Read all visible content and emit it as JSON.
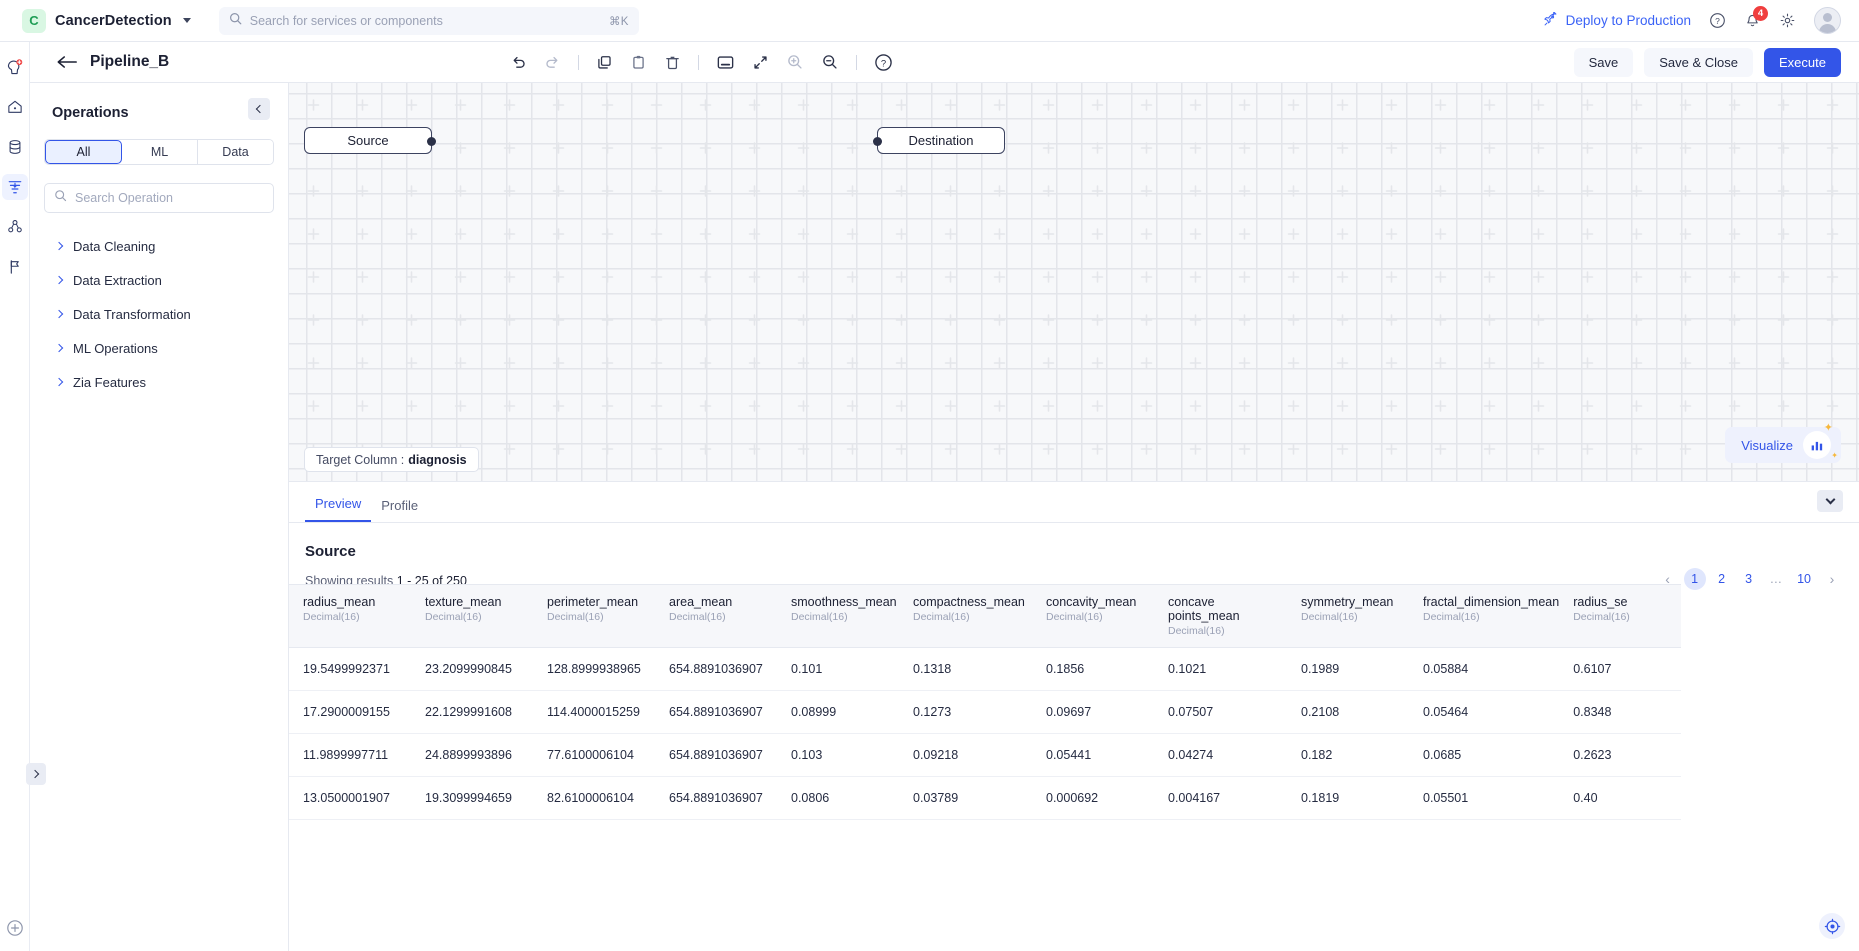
{
  "topbar": {
    "brand_initial": "C",
    "brand_name": "CancerDetection",
    "search_placeholder": "Search for services or components",
    "search_value": "",
    "search_shortcut": "⌘K",
    "deploy_label": "Deploy to Production",
    "notification_count": "4",
    "icons": {
      "search": "search-icon",
      "rocket": "rocket-icon",
      "help": "help-circle-icon",
      "bell": "bell-icon",
      "settings": "gear-icon",
      "avatar": "user-avatar"
    }
  },
  "rail": {
    "items": [
      {
        "name": "add-service-icon",
        "label": "Add Service",
        "active": false
      },
      {
        "name": "home-icon",
        "label": "Home",
        "active": false
      },
      {
        "name": "database-icon",
        "label": "Data Sources",
        "active": false
      },
      {
        "name": "pipeline-icon",
        "label": "Pipelines",
        "active": true
      },
      {
        "name": "models-icon",
        "label": "Models",
        "active": false
      },
      {
        "name": "flag-icon",
        "label": "Experiments",
        "active": false
      }
    ],
    "expand_label": "Expand"
  },
  "pipebar": {
    "back_label": "Back",
    "title": "Pipeline_B",
    "tools": [
      {
        "name": "undo-icon",
        "label": "Undo"
      },
      {
        "name": "redo-icon",
        "label": "Redo"
      },
      {
        "name": "separator",
        "label": ""
      },
      {
        "name": "copy-icon",
        "label": "Copy"
      },
      {
        "name": "paste-icon",
        "label": "Paste"
      },
      {
        "name": "delete-icon",
        "label": "Delete"
      },
      {
        "name": "separator",
        "label": ""
      },
      {
        "name": "minimap-icon",
        "label": "Minimap"
      },
      {
        "name": "fullscreen-icon",
        "label": "Fit to screen"
      },
      {
        "name": "zoom-in-icon",
        "label": "Zoom In"
      },
      {
        "name": "zoom-out-icon",
        "label": "Zoom Out"
      },
      {
        "name": "separator",
        "label": ""
      },
      {
        "name": "help-circle-icon",
        "label": "Help"
      }
    ],
    "save_label": "Save",
    "save_close_label": "Save & Close",
    "execute_label": "Execute"
  },
  "operations": {
    "title": "Operations",
    "collapse_label": "Collapse panel",
    "filters": [
      {
        "label": "All",
        "active": true
      },
      {
        "label": "ML",
        "active": false
      },
      {
        "label": "Data",
        "active": false
      }
    ],
    "search_placeholder": "Search Operation",
    "search_value": "",
    "categories": [
      {
        "label": "Data Cleaning"
      },
      {
        "label": "Data Extraction"
      },
      {
        "label": "Data Transformation"
      },
      {
        "label": "ML Operations"
      },
      {
        "label": "Zia Features"
      }
    ]
  },
  "canvas": {
    "nodes": [
      {
        "id": "source",
        "label": "Source"
      },
      {
        "id": "destination",
        "label": "Destination"
      }
    ],
    "target_column_label": "Target Column :",
    "target_column_value": "diagnosis",
    "visualize_label": "Visualize"
  },
  "bottom_panel": {
    "tabs": [
      {
        "label": "Preview",
        "active": true
      },
      {
        "label": "Profile",
        "active": false
      }
    ],
    "collapse_label": "Collapse results",
    "result_title": "Source",
    "showing_prefix": "Showing results",
    "showing_range": "1 - 25 of 250",
    "pagination": {
      "prev": "‹",
      "next": "›",
      "pages": [
        "1",
        "2",
        "3",
        "…",
        "10"
      ],
      "current": "1"
    },
    "columns": [
      {
        "name": "radius_mean",
        "type": "Decimal(16)"
      },
      {
        "name": "texture_mean",
        "type": "Decimal(16)"
      },
      {
        "name": "perimeter_mean",
        "type": "Decimal(16)"
      },
      {
        "name": "area_mean",
        "type": "Decimal(16)"
      },
      {
        "name": "smoothness_mean",
        "type": "Decimal(16)"
      },
      {
        "name": "compactness_mean",
        "type": "Decimal(16)"
      },
      {
        "name": "concavity_mean",
        "type": "Decimal(16)"
      },
      {
        "name": "concave points_mean",
        "type": "Decimal(16)"
      },
      {
        "name": "symmetry_mean",
        "type": "Decimal(16)"
      },
      {
        "name": "fractal_dimension_mean",
        "type": "Decimal(16)"
      },
      {
        "name": "radius_se",
        "type": "Decimal(16)"
      }
    ],
    "rows": [
      [
        "19.5499992371",
        "23.2099990845",
        "128.8999938965",
        "654.8891036907",
        "0.101",
        "0.1318",
        "0.1856",
        "0.1021",
        "0.1989",
        "0.05884",
        "0.6107"
      ],
      [
        "17.2900009155",
        "22.1299991608",
        "114.4000015259",
        "654.8891036907",
        "0.08999",
        "0.1273",
        "0.09697",
        "0.07507",
        "0.2108",
        "0.05464",
        "0.8348"
      ],
      [
        "11.9899997711",
        "24.8899993896",
        "77.6100006104",
        "654.8891036907",
        "0.103",
        "0.09218",
        "0.05441",
        "0.04274",
        "0.182",
        "0.0685",
        "0.2623"
      ],
      [
        "13.0500001907",
        "19.3099994659",
        "82.6100006104",
        "654.8891036907",
        "0.0806",
        "0.03789",
        "0.000692",
        "0.004167",
        "0.1819",
        "0.05501",
        "0.40"
      ]
    ]
  }
}
